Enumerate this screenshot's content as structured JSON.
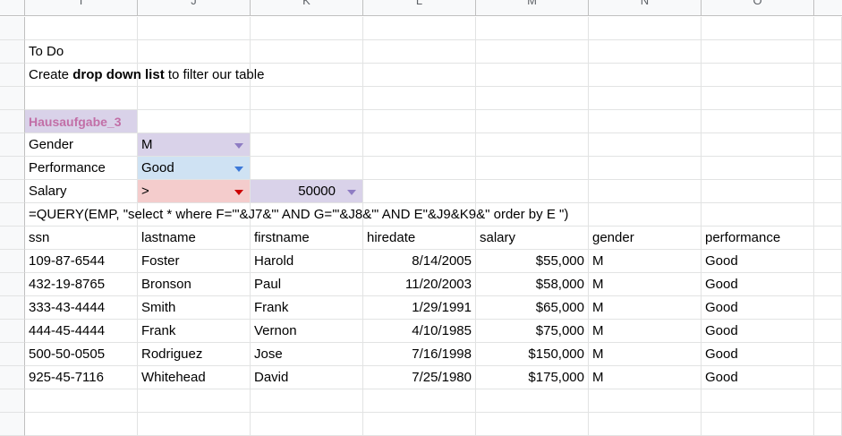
{
  "columns": [
    "I",
    "J",
    "K",
    "L",
    "M",
    "N",
    "O"
  ],
  "todo": {
    "title": "To Do",
    "line_prefix": "Create ",
    "line_bold": "drop down list",
    "line_suffix": " to filter our table"
  },
  "filters": {
    "header": "Hausaufgabe_3",
    "gender_label": "Gender",
    "gender_value": "M",
    "performance_label": "Performance",
    "performance_value": "Good",
    "salary_label": "Salary",
    "salary_operator": ">",
    "salary_value": "50000"
  },
  "formula": "=QUERY(EMP, \"select * where F='\"&J7&\"' AND G='\"&J8&\"' AND E\"&J9&K9&\" order by E \")",
  "table": {
    "headers": [
      "ssn",
      "lastname",
      "firstname",
      "hiredate",
      "salary",
      "gender",
      "performance"
    ],
    "rows": [
      [
        "109-87-6544",
        "Foster",
        "Harold",
        "8/14/2005",
        "$55,000",
        "M",
        "Good"
      ],
      [
        "432-19-8765",
        "Bronson",
        "Paul",
        "11/20/2003",
        "$58,000",
        "M",
        "Good"
      ],
      [
        "333-43-4444",
        "Smith",
        "Frank",
        "1/29/1991",
        "$65,000",
        "M",
        "Good"
      ],
      [
        "444-45-4444",
        "Frank",
        "Vernon",
        "4/10/1985",
        "$75,000",
        "M",
        "Good"
      ],
      [
        "500-50-0505",
        "Rodriguez",
        "Jose",
        "7/16/1998",
        "$150,000",
        "M",
        "Good"
      ],
      [
        "925-45-7116",
        "Whitehead",
        "David",
        "7/25/1980",
        "$175,000",
        "M",
        "Good"
      ]
    ]
  },
  "colors": {
    "gender_bg": "#d9d2e9",
    "performance_bg": "#cfe2f3",
    "salary_bg": "#f4cccc",
    "arrow_purple": "#8e7cc3",
    "arrow_blue": "#3c78d8",
    "arrow_red": "#cc0000"
  }
}
